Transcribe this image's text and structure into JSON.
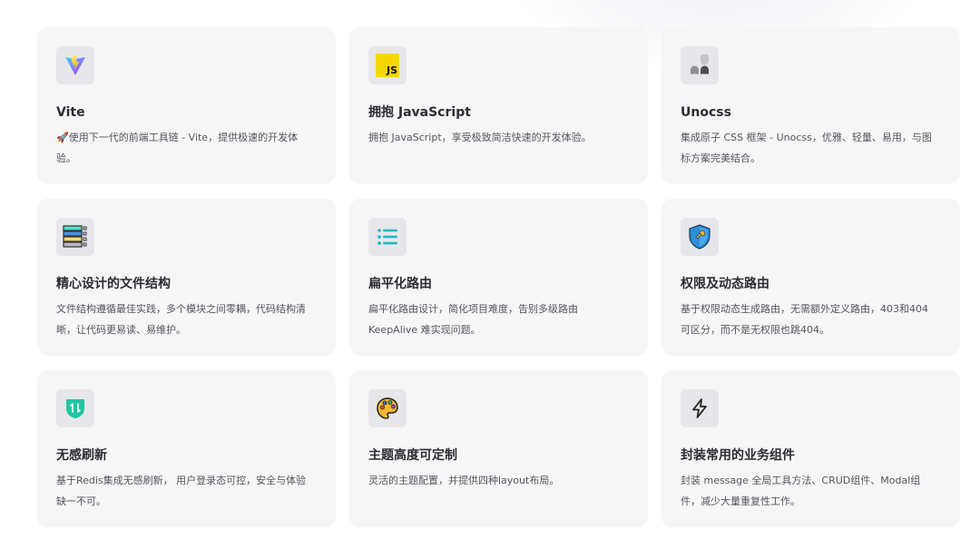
{
  "features": [
    {
      "icon": "vite-logo-icon",
      "title": "Vite",
      "desc": "🚀使用下一代的前端工具链 - Vite，提供极速的开发体验。"
    },
    {
      "icon": "javascript-logo-icon",
      "title": "拥抱 JavaScript",
      "desc": "拥抱 JavaScript，享受极致简洁快速的开发体验。",
      "badge": "JS"
    },
    {
      "icon": "unocss-logo-icon",
      "title": "Unocss",
      "desc": "集成原子 CSS 框架 - Unocss，优雅、轻量、易用，与图标方案完美结合。"
    },
    {
      "icon": "file-structure-icon",
      "title": "精心设计的文件结构",
      "desc": "文件结构遵循最佳实践，多个模块之间零耦，代码结构清晰，让代码更易读、易维护。"
    },
    {
      "icon": "list-icon",
      "title": "扁平化路由",
      "desc": "扁平化路由设计，简化项目难度，告别多级路由KeepAlive 难实现问题。"
    },
    {
      "icon": "shield-key-icon",
      "title": "权限及动态路由",
      "desc": "基于权限动态生成路由，无需额外定义路由，403和404可区分，而不是无权限也跳404。"
    },
    {
      "icon": "refresh-shield-icon",
      "title": "无感刷新",
      "desc": "基于Redis集成无感刷新， 用户登录态可控，安全与体验缺一不可。"
    },
    {
      "icon": "palette-icon",
      "title": "主题高度可定制",
      "desc": "灵活的主题配置，并提供四种layout布局。"
    },
    {
      "icon": "lightning-icon",
      "title": "封装常用的业务组件",
      "desc": "封装 message 全局工具方法、CRUD组件、Modal组件，减少大量重复性工作。"
    }
  ]
}
